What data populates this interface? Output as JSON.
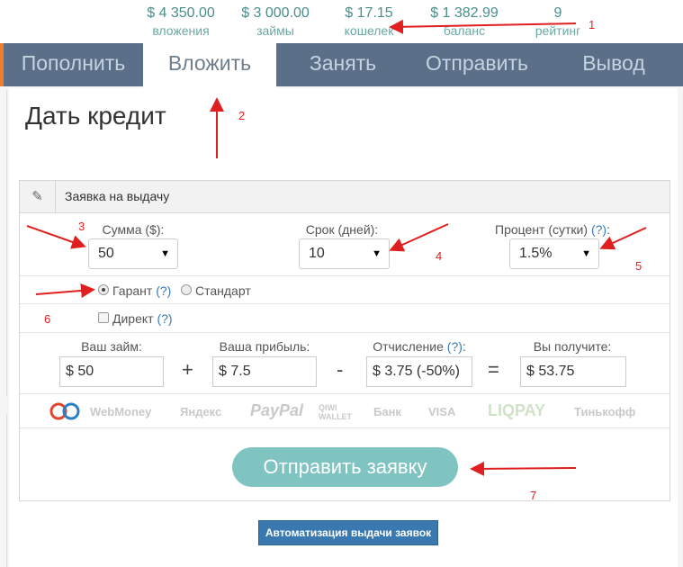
{
  "stats": [
    {
      "value": "$ 4 350.00",
      "label": "вложения"
    },
    {
      "value": "$ 3 000.00",
      "label": "займы"
    },
    {
      "value": "$ 17.15",
      "label": "кошелек"
    },
    {
      "value": "$ 1 382.99",
      "label": "баланс"
    },
    {
      "value": "9",
      "label": "рейтинг"
    }
  ],
  "tabs": [
    "Пополнить",
    "Вложить",
    "Занять",
    "Отправить",
    "Вывод"
  ],
  "active_tab": "Вложить",
  "page_title": "Дать кредит",
  "panel": {
    "title": "Заявка на выдачу",
    "amount_label": "Сумма ($):",
    "amount_value": "50",
    "term_label": "Срок (дней):",
    "term_value": "10",
    "percent_label": "Процент (сутки)",
    "percent_help": "(?)",
    "percent_suffix": ":",
    "percent_value": "1.5%",
    "guarantee_label": "Гарант",
    "guarantee_help": "(?)",
    "standard_label": "Стандарт",
    "direct_label": "Директ",
    "direct_help": "(?)",
    "loan_label": "Ваш займ:",
    "loan_value": "$ 50",
    "profit_label": "Ваша прибыль:",
    "profit_value": "$ 7.5",
    "deduction_label": "Отчисление",
    "deduction_help": "(?)",
    "deduction_suffix": ":",
    "deduction_value": "$ 3.75 (-50%)",
    "receive_label": "Вы получите:",
    "receive_value": "$ 53.75",
    "plus": "+",
    "minus": "-",
    "equals": "=",
    "payments": [
      "WebMoney",
      "Яндекс",
      "PayPal",
      "QIWI WALLET",
      "Банк",
      "VISA",
      "LIQPAY",
      "Тинькофф"
    ],
    "submit_label": "Отправить заявку"
  },
  "auto_button": "Автоматизация выдачи заявок",
  "annotations": [
    "1",
    "2",
    "3",
    "4",
    "5",
    "6",
    "7"
  ],
  "colors": {
    "tab_bg": "#5b7088",
    "accent_teal": "#7fc4c1",
    "stat_teal": "#4a8f8c",
    "annotation_red": "#e02020",
    "auto_button": "#3a79b0"
  }
}
